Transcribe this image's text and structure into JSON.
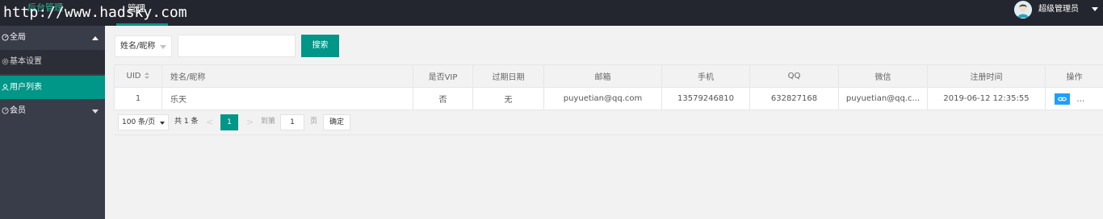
{
  "watermark": "http://www.hadsky.com",
  "header": {
    "brand": "后台管理",
    "top_tab": "管理",
    "user_name": "超级管理员"
  },
  "sidebar": {
    "items": [
      {
        "label": "全局",
        "icon": "gauge-icon",
        "type": "group",
        "expanded": true
      },
      {
        "label": "基本设置",
        "icon": "gear-icon",
        "type": "sub"
      },
      {
        "label": "用户列表",
        "icon": "user-icon",
        "type": "active"
      },
      {
        "label": "会员",
        "icon": "gauge-icon",
        "type": "group",
        "expanded": false
      }
    ]
  },
  "toolbar": {
    "field_select": "姓名/昵称",
    "search_value": "",
    "search_label": "搜索"
  },
  "table": {
    "headers": [
      "UID",
      "姓名/昵称",
      "是否VIP",
      "过期日期",
      "邮箱",
      "手机",
      "QQ",
      "微信",
      "注册时间",
      "操作"
    ],
    "rows": [
      {
        "uid": "1",
        "name": "乐天",
        "vip": "否",
        "expire": "无",
        "email": "puyuetian@qq.com",
        "phone": "13579246810",
        "qq": "632827168",
        "wechat": "puyuetian@qq.c...",
        "register_time": "2019-06-12 12:35:55"
      }
    ]
  },
  "pager": {
    "page_size": "100 条/页",
    "total": "共 1 条",
    "prev": "<",
    "current_page": "1",
    "next": ">",
    "goto_label": "到第",
    "goto_value": "1",
    "page_unit": "页",
    "confirm_label": "确定"
  },
  "colors": {
    "header_bg": "#23262e",
    "sidebar_bg": "#393d49",
    "accent": "#009688",
    "edit": "#1e9fff",
    "delete": "#ff5722"
  }
}
